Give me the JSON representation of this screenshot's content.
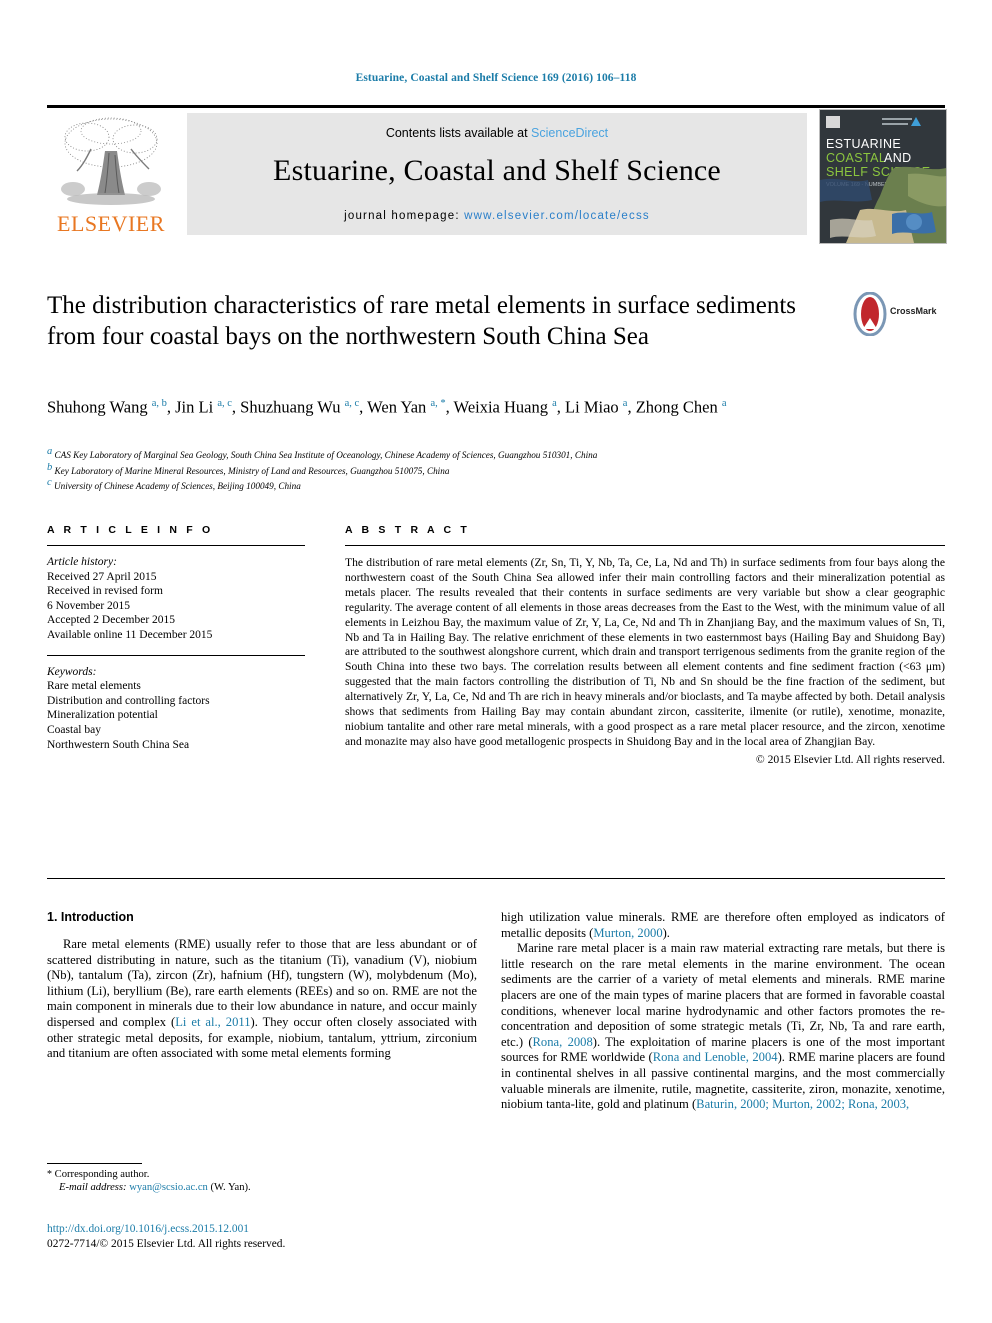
{
  "running_head": "Estuarine, Coastal and Shelf Science 169 (2016) 106–118",
  "masthead": {
    "contents_prefix": "Contents lists available at ",
    "sciencedirect": "ScienceDirect",
    "journal_title": "Estuarine, Coastal and Shelf Science",
    "homepage_prefix": "journal homepage: ",
    "homepage_url": "www.elsevier.com/locate/ecss",
    "publisher_name": "ELSEVIER",
    "cover_lines": [
      "ESTUARINE",
      "COASTAL AND",
      "SHELF SCIENCE"
    ],
    "publisher_color": "#e87722",
    "link_color": "#2a7fc9"
  },
  "crossmark": {
    "label": "CrossMark"
  },
  "article": {
    "title": "The distribution characteristics of rare metal elements in surface sediments from four coastal bays on the northwestern South China Sea",
    "authors_html": "Shuhong Wang <sup>a, b</sup>, Jin Li <sup>a, c</sup>, Shuzhuang Wu <sup>a, c</sup>, Wen Yan <sup>a, *</sup>, Weixia Huang <sup>a</sup>, Li Miao <sup>a</sup>, Zhong Chen <sup>a</sup>",
    "affiliations": [
      "CAS Key Laboratory of Marginal Sea Geology, South China Sea Institute of Oceanology, Chinese Academy of Sciences, Guangzhou 510301, China",
      "Key Laboratory of Marine Mineral Resources, Ministry of Land and Resources, Guangzhou 510075, China",
      "University of Chinese Academy of Sciences, Beijing 100049, China"
    ],
    "affiliation_marks": [
      "a",
      "b",
      "c"
    ]
  },
  "article_info": {
    "heading": "A R T I C L E   I N F O",
    "history_label": "Article history:",
    "history": [
      "Received 27 April 2015",
      "Received in revised form",
      "6 November 2015",
      "Accepted 2 December 2015",
      "Available online 11 December 2015"
    ],
    "keywords_label": "Keywords:",
    "keywords": [
      "Rare metal elements",
      "Distribution and controlling factors",
      "Mineralization potential",
      "Coastal bay",
      "Northwestern South China Sea"
    ]
  },
  "abstract": {
    "heading": "A B S T R A C T",
    "text": "The distribution of rare metal elements (Zr, Sn, Ti, Y, Nb, Ta, Ce, La, Nd and Th) in surface sediments from four bays along the northwestern coast of the South China Sea allowed infer their main controlling factors and their mineralization potential as metals placer. The results revealed that their contents in surface sediments are very variable but show a clear geographic regularity. The average content of all elements in those areas decreases from the East to the West, with the minimum value of all elements in Leizhou Bay, the maximum value of Zr, Y, La, Ce, Nd and Th in Zhanjiang Bay, and the maximum values of Sn, Ti, Nb and Ta in Hailing Bay. The relative enrichment of these elements in two easternmost bays (Hailing Bay and Shuidong Bay) are attributed to the southwest alongshore current, which drain and transport terrigenous sediments from the granite region of the South China into these two bays. The correlation results between all element contents and fine sediment fraction (<63 μm) suggested that the main factors controlling the distribution of Ti, Nb and Sn should be the fine fraction of the sediment, but alternatively Zr, Y, La, Ce, Nd and Th are rich in heavy minerals and/or bioclasts, and Ta maybe affected by both. Detail analysis shows that sediments from Hailing Bay may contain abundant zircon, cassiterite, ilmenite (or rutile), xenotime, monazite, niobium tantalite and other rare metal minerals, with a good prospect as a rare metal placer resource, and the zircon, xenotime and monazite may also have good metallogenic prospects in Shuidong Bay and in the local area of Zhangjian Bay.",
    "copyright": "© 2015 Elsevier Ltd. All rights reserved."
  },
  "introduction": {
    "heading": "1. Introduction",
    "left_paragraph_1_html": "Rare metal elements (RME) usually refer to those that are less abundant or of scattered distributing in nature, such as the titanium (Ti), vanadium (V), niobium (Nb), tantalum (Ta), zircon (Zr), hafnium (Hf), tungstern (W), molybdenum (Mo), lithium (Li), beryllium (Be), rare earth elements (REEs) and so on. RME are not the main component in minerals due to their low abundance in nature, and occur mainly dispersed and complex (<span class=\"ref\" data-name=\"citation-link\" data-interactable=\"true\">Li et al., 2011</span>). They occur often closely associated with other strategic metal deposits, for example, niobium, tantalum, yttrium, zirconium and titanium are often associated with some metal elements forming",
    "right_paragraph_1_html": "high utilization value minerals. RME are therefore often employed as indicators of metallic deposits (<span class=\"ref\" data-name=\"citation-link\" data-interactable=\"true\">Murton, 2000</span>).",
    "right_paragraph_2_html": "Marine rare metal placer is a main raw material extracting rare metals, but there is little research on the rare metal elements in the marine environment. The ocean sediments are the carrier of a variety of metal elements and minerals. RME marine placers are one of the main types of marine placers that are formed in favorable coastal conditions, whenever local marine hydrodynamic and other factors promotes the re-concentration and deposition of some strategic metals (Ti, Zr, Nb, Ta and rare earth, etc.) (<span class=\"ref\" data-name=\"citation-link\" data-interactable=\"true\">Rona, 2008</span>). The exploitation of marine placers is one of the most important sources for RME worldwide (<span class=\"ref\" data-name=\"citation-link\" data-interactable=\"true\">Rona and Lenoble, 2004</span>). RME marine placers are found in continental shelves in all passive continental margins, and the most commercially valuable minerals are ilmenite, rutile, magnetite, cassiterite, ziron, monazite, xenotime, niobium tanta-lite, gold and platinum (<span class=\"ref\" data-name=\"citation-link\" data-interactable=\"true\">Baturin, 2000; Murton, 2002; Rona, 2003,</span>"
  },
  "footer": {
    "corresponding_marker": "*",
    "corresponding_label": "Corresponding author.",
    "email_label": "E-mail address:",
    "email": "wyan@scsio.ac.cn",
    "email_suffix": "(W. Yan).",
    "doi_url": "http://dx.doi.org/10.1016/j.ecss.2015.12.001",
    "issn_line": "0272-7714/© 2015 Elsevier Ltd. All rights reserved."
  }
}
